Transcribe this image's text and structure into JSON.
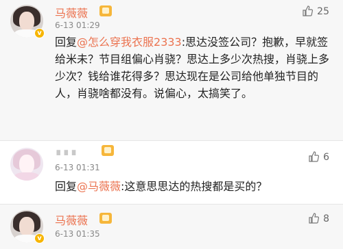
{
  "comments": [
    {
      "username": "马薇薇",
      "time": "6-13 01:29",
      "likes": "25",
      "content_prefix": "回复",
      "reply_to": "@怎么穿我衣服2333",
      "content": ":思达没签公司？抱歉，早就签给米未？节目组偏心肖骁？思达上多少次热搜，肖骁上多少次？钱给谁花得多？思达现在是公司给他单独节目的人，肖骁啥都没有。说偏心，太搞笑了。"
    },
    {
      "username": "∎∎∎",
      "time": "6-13 01:31",
      "likes": "6",
      "content_prefix": "回复",
      "reply_to": "@马薇薇",
      "content": ":这意思思达的热搜都是买的？"
    },
    {
      "username": "马薇薇",
      "time": "6-13 01:35",
      "likes": "8",
      "content_prefix": "",
      "reply_to": "",
      "content": ""
    }
  ],
  "colors": {
    "accent": "#eb7350",
    "badge": "#f6b63a",
    "verified": "#f7b500"
  },
  "icons": {
    "like": "thumbs-up-icon",
    "verified": "verified-v-icon",
    "member": "member-crown-icon"
  }
}
